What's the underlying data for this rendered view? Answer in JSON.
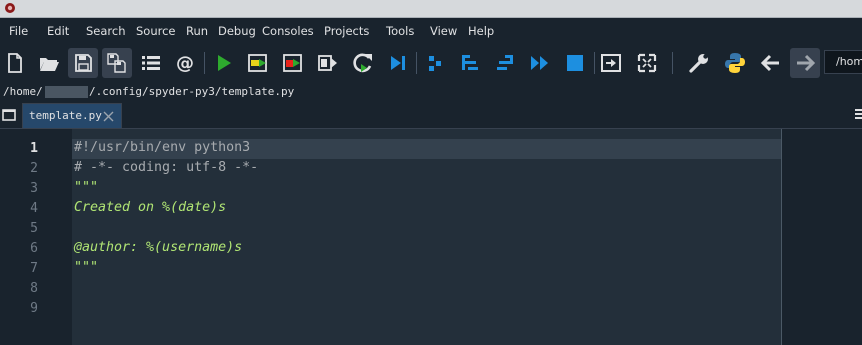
{
  "menu": [
    "File",
    "Edit",
    "Search",
    "Source",
    "Run",
    "Debug",
    "Consoles",
    "Projects",
    "Tools",
    "View",
    "Help"
  ],
  "toolbar": {
    "path_value": "/home"
  },
  "file_path": {
    "prefix": "/home/",
    "suffix": "/.config/spyder-py3/template.py"
  },
  "tabs": [
    {
      "label": "template.py",
      "active": true
    }
  ],
  "editor": {
    "active_line": 1,
    "line_numbers": [
      "1",
      "2",
      "3",
      "4",
      "5",
      "6",
      "7",
      "8",
      "9"
    ],
    "lines": [
      {
        "text": "#!/usr/bin/env python3",
        "kind": "comment"
      },
      {
        "text": "# -*- coding: utf-8 -*-",
        "kind": "comment"
      },
      {
        "text": "\"\"\"",
        "kind": "docstring"
      },
      {
        "text": "Created on %(date)s",
        "kind": "docstring"
      },
      {
        "text": "",
        "kind": "docstring"
      },
      {
        "text": "@author: %(username)s",
        "kind": "docstring"
      },
      {
        "text": "\"\"\"",
        "kind": "docstring"
      },
      {
        "text": "",
        "kind": "plain"
      },
      {
        "text": "",
        "kind": "plain"
      }
    ]
  },
  "colors": {
    "background": "#19232d",
    "editor_bg": "#232f3a",
    "comment": "#a7abaf",
    "docstring": "#b0e574",
    "tab_active": "#26486b",
    "run_green": "#2eaa2e",
    "debug_blue": "#1d8fe0"
  }
}
